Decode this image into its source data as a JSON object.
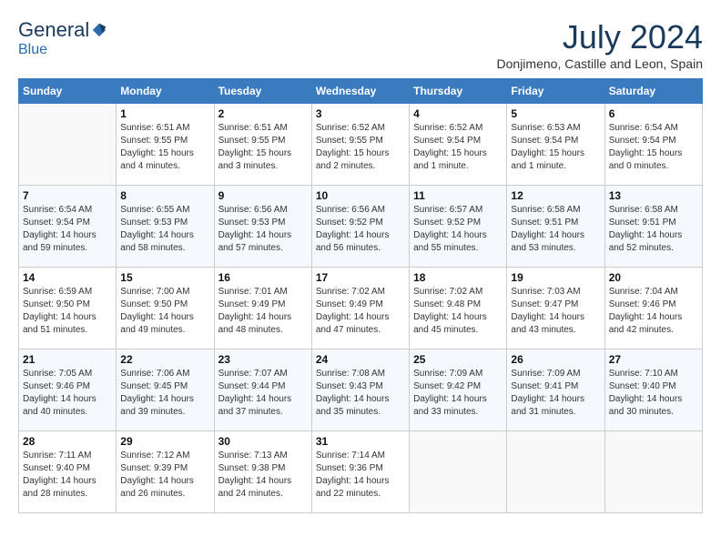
{
  "header": {
    "logo_general": "General",
    "logo_blue": "Blue",
    "title": "July 2024",
    "location": "Donjimeno, Castille and Leon, Spain"
  },
  "weekdays": [
    "Sunday",
    "Monday",
    "Tuesday",
    "Wednesday",
    "Thursday",
    "Friday",
    "Saturday"
  ],
  "weeks": [
    [
      {
        "day": "",
        "info": ""
      },
      {
        "day": "1",
        "info": "Sunrise: 6:51 AM\nSunset: 9:55 PM\nDaylight: 15 hours\nand 4 minutes."
      },
      {
        "day": "2",
        "info": "Sunrise: 6:51 AM\nSunset: 9:55 PM\nDaylight: 15 hours\nand 3 minutes."
      },
      {
        "day": "3",
        "info": "Sunrise: 6:52 AM\nSunset: 9:55 PM\nDaylight: 15 hours\nand 2 minutes."
      },
      {
        "day": "4",
        "info": "Sunrise: 6:52 AM\nSunset: 9:54 PM\nDaylight: 15 hours\nand 1 minute."
      },
      {
        "day": "5",
        "info": "Sunrise: 6:53 AM\nSunset: 9:54 PM\nDaylight: 15 hours\nand 1 minute."
      },
      {
        "day": "6",
        "info": "Sunrise: 6:54 AM\nSunset: 9:54 PM\nDaylight: 15 hours\nand 0 minutes."
      }
    ],
    [
      {
        "day": "7",
        "info": "Sunrise: 6:54 AM\nSunset: 9:54 PM\nDaylight: 14 hours\nand 59 minutes."
      },
      {
        "day": "8",
        "info": "Sunrise: 6:55 AM\nSunset: 9:53 PM\nDaylight: 14 hours\nand 58 minutes."
      },
      {
        "day": "9",
        "info": "Sunrise: 6:56 AM\nSunset: 9:53 PM\nDaylight: 14 hours\nand 57 minutes."
      },
      {
        "day": "10",
        "info": "Sunrise: 6:56 AM\nSunset: 9:52 PM\nDaylight: 14 hours\nand 56 minutes."
      },
      {
        "day": "11",
        "info": "Sunrise: 6:57 AM\nSunset: 9:52 PM\nDaylight: 14 hours\nand 55 minutes."
      },
      {
        "day": "12",
        "info": "Sunrise: 6:58 AM\nSunset: 9:51 PM\nDaylight: 14 hours\nand 53 minutes."
      },
      {
        "day": "13",
        "info": "Sunrise: 6:58 AM\nSunset: 9:51 PM\nDaylight: 14 hours\nand 52 minutes."
      }
    ],
    [
      {
        "day": "14",
        "info": "Sunrise: 6:59 AM\nSunset: 9:50 PM\nDaylight: 14 hours\nand 51 minutes."
      },
      {
        "day": "15",
        "info": "Sunrise: 7:00 AM\nSunset: 9:50 PM\nDaylight: 14 hours\nand 49 minutes."
      },
      {
        "day": "16",
        "info": "Sunrise: 7:01 AM\nSunset: 9:49 PM\nDaylight: 14 hours\nand 48 minutes."
      },
      {
        "day": "17",
        "info": "Sunrise: 7:02 AM\nSunset: 9:49 PM\nDaylight: 14 hours\nand 47 minutes."
      },
      {
        "day": "18",
        "info": "Sunrise: 7:02 AM\nSunset: 9:48 PM\nDaylight: 14 hours\nand 45 minutes."
      },
      {
        "day": "19",
        "info": "Sunrise: 7:03 AM\nSunset: 9:47 PM\nDaylight: 14 hours\nand 43 minutes."
      },
      {
        "day": "20",
        "info": "Sunrise: 7:04 AM\nSunset: 9:46 PM\nDaylight: 14 hours\nand 42 minutes."
      }
    ],
    [
      {
        "day": "21",
        "info": "Sunrise: 7:05 AM\nSunset: 9:46 PM\nDaylight: 14 hours\nand 40 minutes."
      },
      {
        "day": "22",
        "info": "Sunrise: 7:06 AM\nSunset: 9:45 PM\nDaylight: 14 hours\nand 39 minutes."
      },
      {
        "day": "23",
        "info": "Sunrise: 7:07 AM\nSunset: 9:44 PM\nDaylight: 14 hours\nand 37 minutes."
      },
      {
        "day": "24",
        "info": "Sunrise: 7:08 AM\nSunset: 9:43 PM\nDaylight: 14 hours\nand 35 minutes."
      },
      {
        "day": "25",
        "info": "Sunrise: 7:09 AM\nSunset: 9:42 PM\nDaylight: 14 hours\nand 33 minutes."
      },
      {
        "day": "26",
        "info": "Sunrise: 7:09 AM\nSunset: 9:41 PM\nDaylight: 14 hours\nand 31 minutes."
      },
      {
        "day": "27",
        "info": "Sunrise: 7:10 AM\nSunset: 9:40 PM\nDaylight: 14 hours\nand 30 minutes."
      }
    ],
    [
      {
        "day": "28",
        "info": "Sunrise: 7:11 AM\nSunset: 9:40 PM\nDaylight: 14 hours\nand 28 minutes."
      },
      {
        "day": "29",
        "info": "Sunrise: 7:12 AM\nSunset: 9:39 PM\nDaylight: 14 hours\nand 26 minutes."
      },
      {
        "day": "30",
        "info": "Sunrise: 7:13 AM\nSunset: 9:38 PM\nDaylight: 14 hours\nand 24 minutes."
      },
      {
        "day": "31",
        "info": "Sunrise: 7:14 AM\nSunset: 9:36 PM\nDaylight: 14 hours\nand 22 minutes."
      },
      {
        "day": "",
        "info": ""
      },
      {
        "day": "",
        "info": ""
      },
      {
        "day": "",
        "info": ""
      }
    ]
  ]
}
